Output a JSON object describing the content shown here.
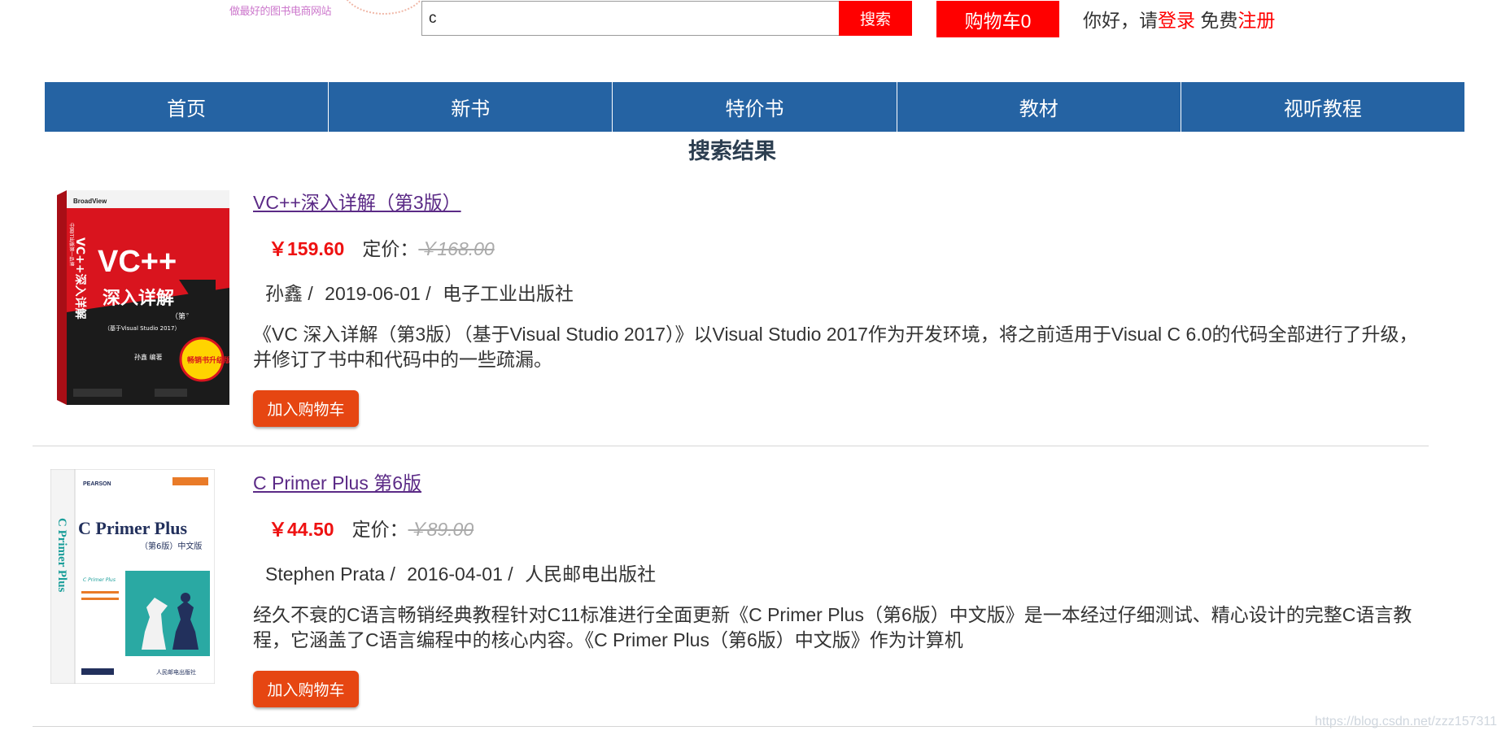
{
  "header": {
    "tagline": "做最好的图书电商网站",
    "search_value": "c",
    "search_button": "搜索",
    "cart_label": "购物车0",
    "greeting_prefix": "你好，请",
    "login_link": "登录",
    "greeting_mid": " 免费",
    "register_link": "注册"
  },
  "nav": {
    "items": [
      {
        "label": "首页"
      },
      {
        "label": "新书"
      },
      {
        "label": "特价书"
      },
      {
        "label": "教材"
      },
      {
        "label": "视听教程"
      }
    ]
  },
  "results": {
    "title": "搜索结果",
    "price_label": "定价：",
    "add_to_cart": "加入购物车",
    "books": [
      {
        "title": "VC++深入详解（第3版）",
        "price": "￥159.60",
        "list_price": "￥168.00",
        "author": "孙鑫 /",
        "date": "2019-06-01 /",
        "publisher": "电子工业出版社",
        "description": "《VC 深入详解（第3版）（基于Visual Studio 2017）》以Visual Studio 2017作为开发环境，将之前适用于Visual C 6.0的代码全部进行了升级，并修订了书中和代码中的一些疏漏。",
        "cover": {
          "brand": "BroadView",
          "series": "中国IT出版第一品牌",
          "title_main": "VC++",
          "title_sub": "深入详解",
          "spine_title": "VC++深入详解",
          "edition": "（第3版）",
          "subtitle": "（基于Visual Studio 2017）",
          "author": "孙鑫 编著",
          "badge": "畅销书升级版",
          "colors": {
            "red": "#d9141e",
            "black": "#1b1b1b",
            "yellow": "#ffd400"
          }
        }
      },
      {
        "title": "C Primer Plus 第6版",
        "price": "￥44.50",
        "list_price": "￥89.00",
        "author": "Stephen Prata /",
        "date": "2016-04-01 /",
        "publisher": "人民邮电出版社",
        "description": "经久不衰的C语言畅销经典教程针对C11标准进行全面更新《C Primer Plus（第6版）中文版》是一本经过仔细测试、精心设计的完整C语言教程，它涵盖了C语言编程中的核心内容。《C Primer Plus（第6版）中文版》作为计算机",
        "cover": {
          "brand": "PEARSON",
          "title": "C Primer Plus",
          "edition": "（第6版）中文版",
          "spine_title": "C Primer Plus",
          "publisher": "人民邮电出版社",
          "colors": {
            "teal": "#1a9e9a",
            "navy": "#22305c"
          }
        }
      }
    ]
  },
  "watermark": "https://blog.csdn.net/zzz157311"
}
